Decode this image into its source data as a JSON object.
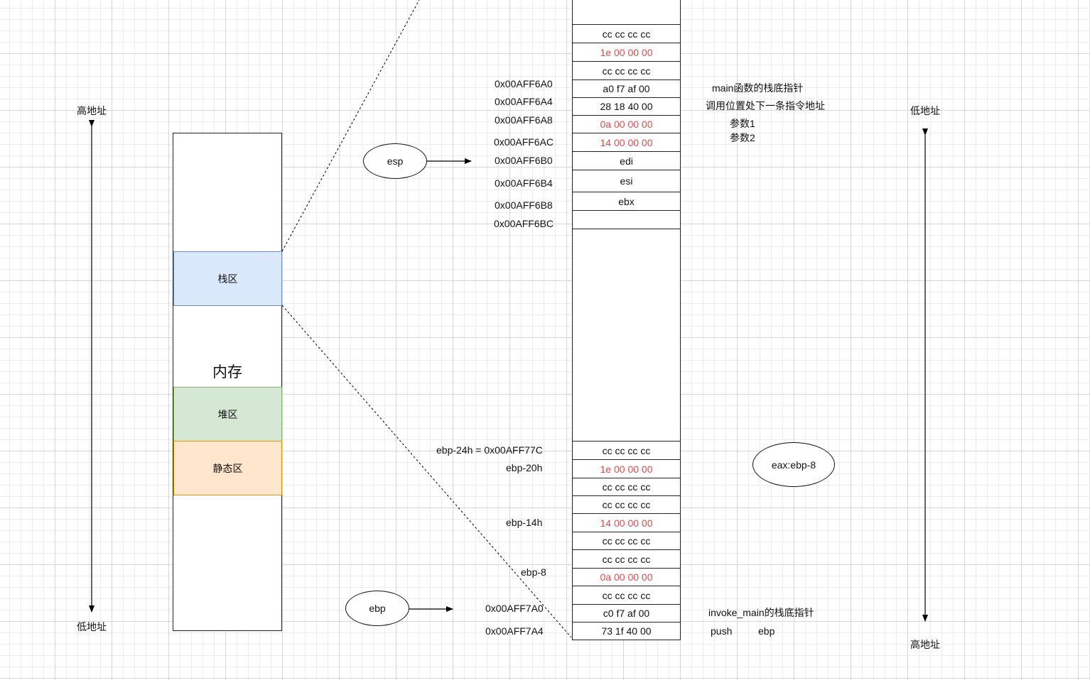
{
  "left_axis": {
    "top_label": "高地址",
    "bottom_label": "低地址"
  },
  "right_axis": {
    "top_label": "低地址",
    "bottom_label": "高地址"
  },
  "memory": {
    "title": "内存",
    "regions": {
      "stack": "栈区",
      "heap": "堆区",
      "static": "静态区"
    },
    "colors": {
      "stack_fill": "#dae8fc",
      "stack_border": "#6c8ebf",
      "heap_fill": "#d5e8d4",
      "heap_border": "#82b366",
      "static_fill": "#ffe6cc",
      "static_border": "#d79b00"
    }
  },
  "pointers": {
    "esp": "esp",
    "ebp": "ebp",
    "eax": "eax:ebp-8"
  },
  "stack_top_cells": [
    {
      "value": "cc cc cc cc",
      "red": false,
      "addr": ""
    },
    {
      "value": "1e 00 00 00",
      "red": true,
      "addr": ""
    },
    {
      "value": "cc cc cc cc",
      "red": false,
      "addr": ""
    },
    {
      "value": "a0 f7 af 00",
      "red": false,
      "addr": "0x00AFF6A0"
    },
    {
      "value": "28 18 40 00",
      "red": false,
      "addr": "0x00AFF6A4"
    },
    {
      "value": "0a 00 00 00",
      "red": true,
      "addr": "0x00AFF6A8"
    },
    {
      "value": "14 00 00 00",
      "red": true,
      "addr": "0x00AFF6AC"
    },
    {
      "value": "edi",
      "red": false,
      "addr": "0x00AFF6B0"
    },
    {
      "value": "esi",
      "red": false,
      "addr": "0x00AFF6B4"
    },
    {
      "value": "ebx",
      "red": false,
      "addr": "0x00AFF6B8"
    },
    {
      "value": "",
      "red": false,
      "addr": "0x00AFF6BC"
    }
  ],
  "stack_bottom_cells": [
    {
      "value": "cc cc cc cc",
      "red": false,
      "addr": "ebp-24h = 0x00AFF77C"
    },
    {
      "value": "1e 00 00 00",
      "red": true,
      "addr": "ebp-20h"
    },
    {
      "value": "cc cc cc cc",
      "red": false,
      "addr": ""
    },
    {
      "value": "cc cc cc cc",
      "red": false,
      "addr": ""
    },
    {
      "value": "14 00 00 00",
      "red": true,
      "addr": "ebp-14h"
    },
    {
      "value": "cc cc cc cc",
      "red": false,
      "addr": ""
    },
    {
      "value": "cc cc cc cc",
      "red": false,
      "addr": ""
    },
    {
      "value": "0a 00 00 00",
      "red": true,
      "addr": "ebp-8"
    },
    {
      "value": "cc cc cc cc",
      "red": false,
      "addr": ""
    },
    {
      "value": "c0 f7 af 00",
      "red": false,
      "addr": "0x00AFF7A0"
    },
    {
      "value": "73 1f 40 00",
      "red": false,
      "addr": "0x00AFF7A4"
    }
  ],
  "notes": {
    "main_frame": "main函数的栈底指针",
    "return_addr": "调用位置处下一条指令地址",
    "param1": "参数1",
    "param2": "参数2",
    "invoke_main": "invoke_main的栈底指针",
    "push": "push",
    "push_reg": "ebp"
  }
}
